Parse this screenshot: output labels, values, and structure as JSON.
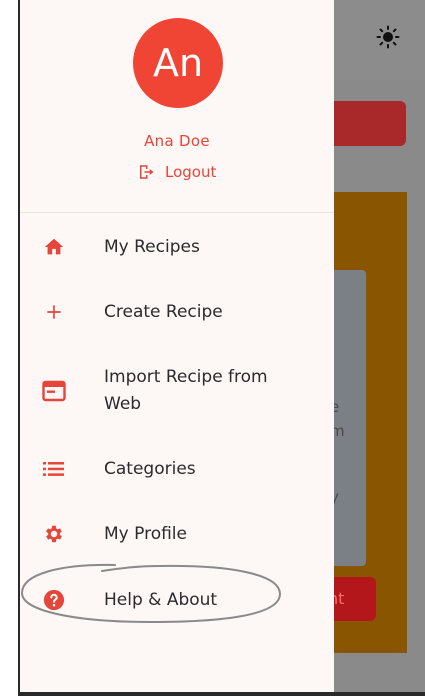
{
  "user": {
    "initials": "An",
    "name": "Ana Doe",
    "logout_label": "Logout"
  },
  "menu": {
    "items": [
      {
        "label": "My Recipes",
        "icon": "home-icon"
      },
      {
        "label": "Create Recipe",
        "icon": "plus-icon"
      },
      {
        "label": "Import Recipe from Web",
        "icon": "web-window-icon"
      },
      {
        "label": "Categories",
        "icon": "list-icon"
      },
      {
        "label": "My Profile",
        "icon": "gear-icon"
      },
      {
        "label": "Help & About",
        "icon": "help-circle-icon"
      }
    ]
  },
  "background": {
    "card_lines": [
      "e",
      "m",
      "y"
    ],
    "button_fragment": "nt"
  },
  "colors": {
    "accent": "#f04434",
    "text": "#2b2b2b",
    "drawer_bg": "#fdf7f6"
  }
}
